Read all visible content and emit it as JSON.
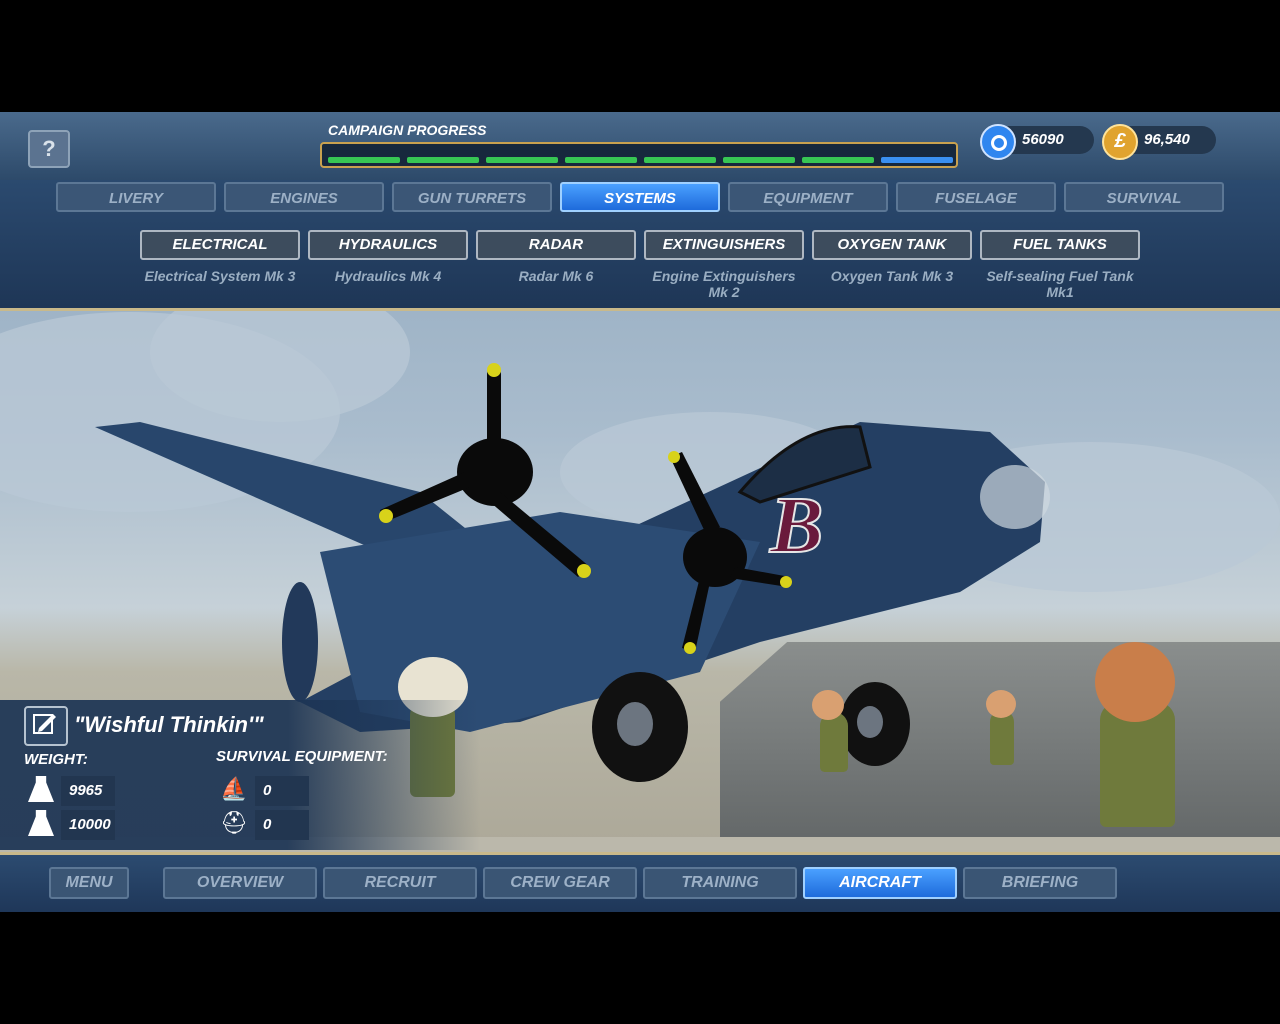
{
  "header": {
    "help_label": "?",
    "campaign_label": "CAMPAIGN PROGRESS",
    "progress": {
      "completed_segments": 7,
      "total_segments": 8
    },
    "currency": {
      "points": "56090",
      "money": "96,540"
    }
  },
  "tabs": {
    "items": [
      "LIVERY",
      "ENGINES",
      "GUN TURRETS",
      "SYSTEMS",
      "EQUIPMENT",
      "FUSELAGE",
      "SURVIVAL"
    ],
    "active": "SYSTEMS"
  },
  "systems": [
    {
      "label": "ELECTRICAL",
      "value": "Electrical System Mk 3"
    },
    {
      "label": "HYDRAULICS",
      "value": "Hydraulics Mk 4"
    },
    {
      "label": "RADAR",
      "value": "Radar Mk 6"
    },
    {
      "label": "EXTINGUISHERS",
      "value": "Engine Extinguishers Mk 2"
    },
    {
      "label": "OXYGEN TANK",
      "value": "Oxygen Tank Mk 3"
    },
    {
      "label": "FUEL TANKS",
      "value": "Self-sealing Fuel Tank Mk1"
    }
  ],
  "aircraft": {
    "name": "\"Wishful Thinkin'\"",
    "nose_letter": "B",
    "weight_label": "WEIGHT:",
    "weight": "9965",
    "max_weight": "10000",
    "survival_label": "SURVIVAL EQUIPMENT:",
    "survival_a": "0",
    "survival_b": "0"
  },
  "bottom_nav": {
    "menu": "MENU",
    "items": [
      "OVERVIEW",
      "RECRUIT",
      "CREW GEAR",
      "TRAINING",
      "AIRCRAFT",
      "BRIEFING"
    ],
    "active": "AIRCRAFT"
  },
  "colors": {
    "accent": "#2f86ef",
    "progress_done": "#37c654",
    "gold": "#c9a14f",
    "bomber": "#243f63"
  }
}
